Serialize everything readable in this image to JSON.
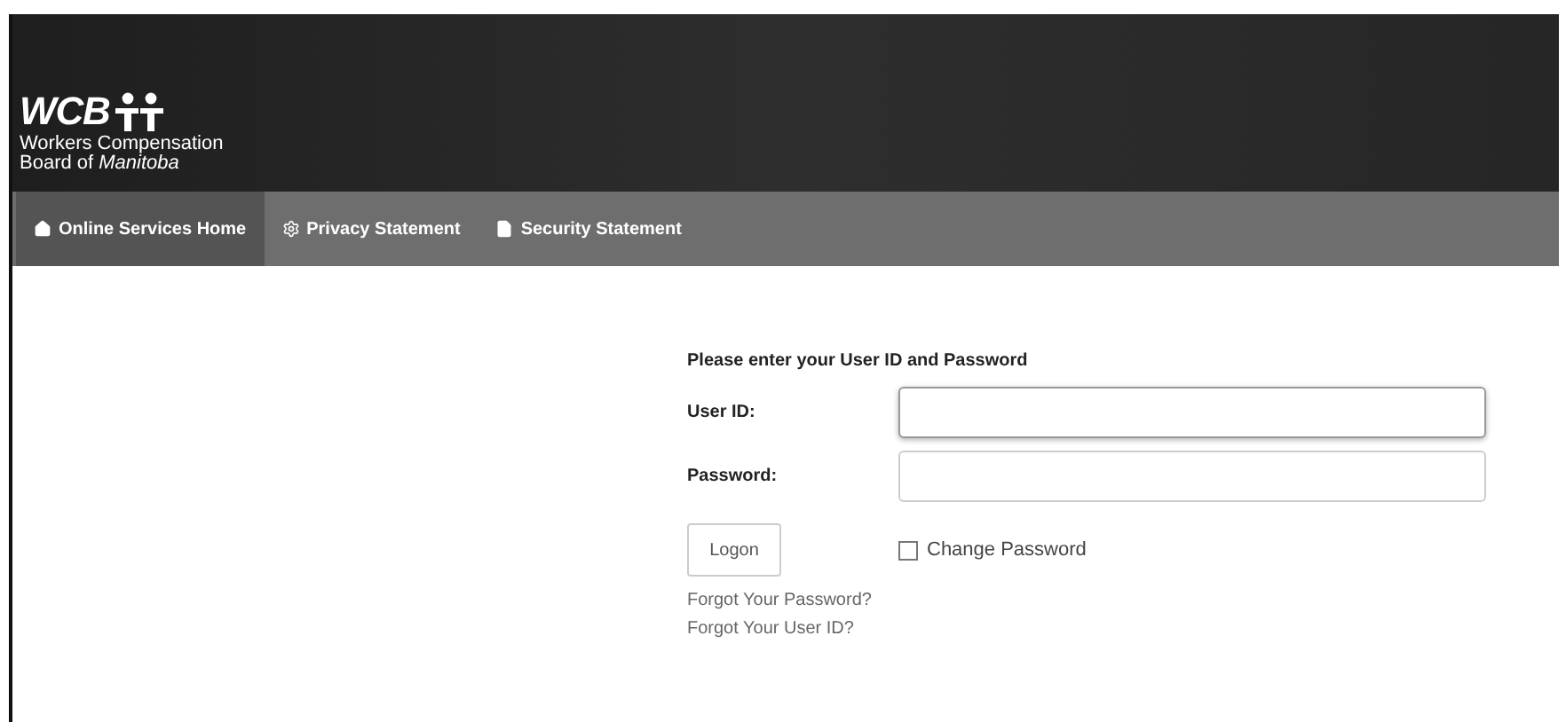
{
  "logo": {
    "wordmark": "WCB",
    "line_1": "Workers Compensation",
    "line_2": "Board of *Manitoba*"
  },
  "nav": [
    {
      "label": "Online Services Home",
      "kind": "home",
      "selected": true
    },
    {
      "label": "Privacy Statement",
      "kind": "gear",
      "selected": false
    },
    {
      "label": "Security Statement",
      "kind": "document",
      "selected": false
    }
  ],
  "form": {
    "heading": "Please enter your User ID and Password",
    "fields": [
      {
        "label": "User ID:"
      },
      {
        "label": "Password:"
      }
    ],
    "logon_button": "Logon",
    "change_password": {
      "label": "Change Password",
      "checked": false
    },
    "links": [
      "Forgot Your Password?",
      "Forgot Your User ID?"
    ]
  }
}
